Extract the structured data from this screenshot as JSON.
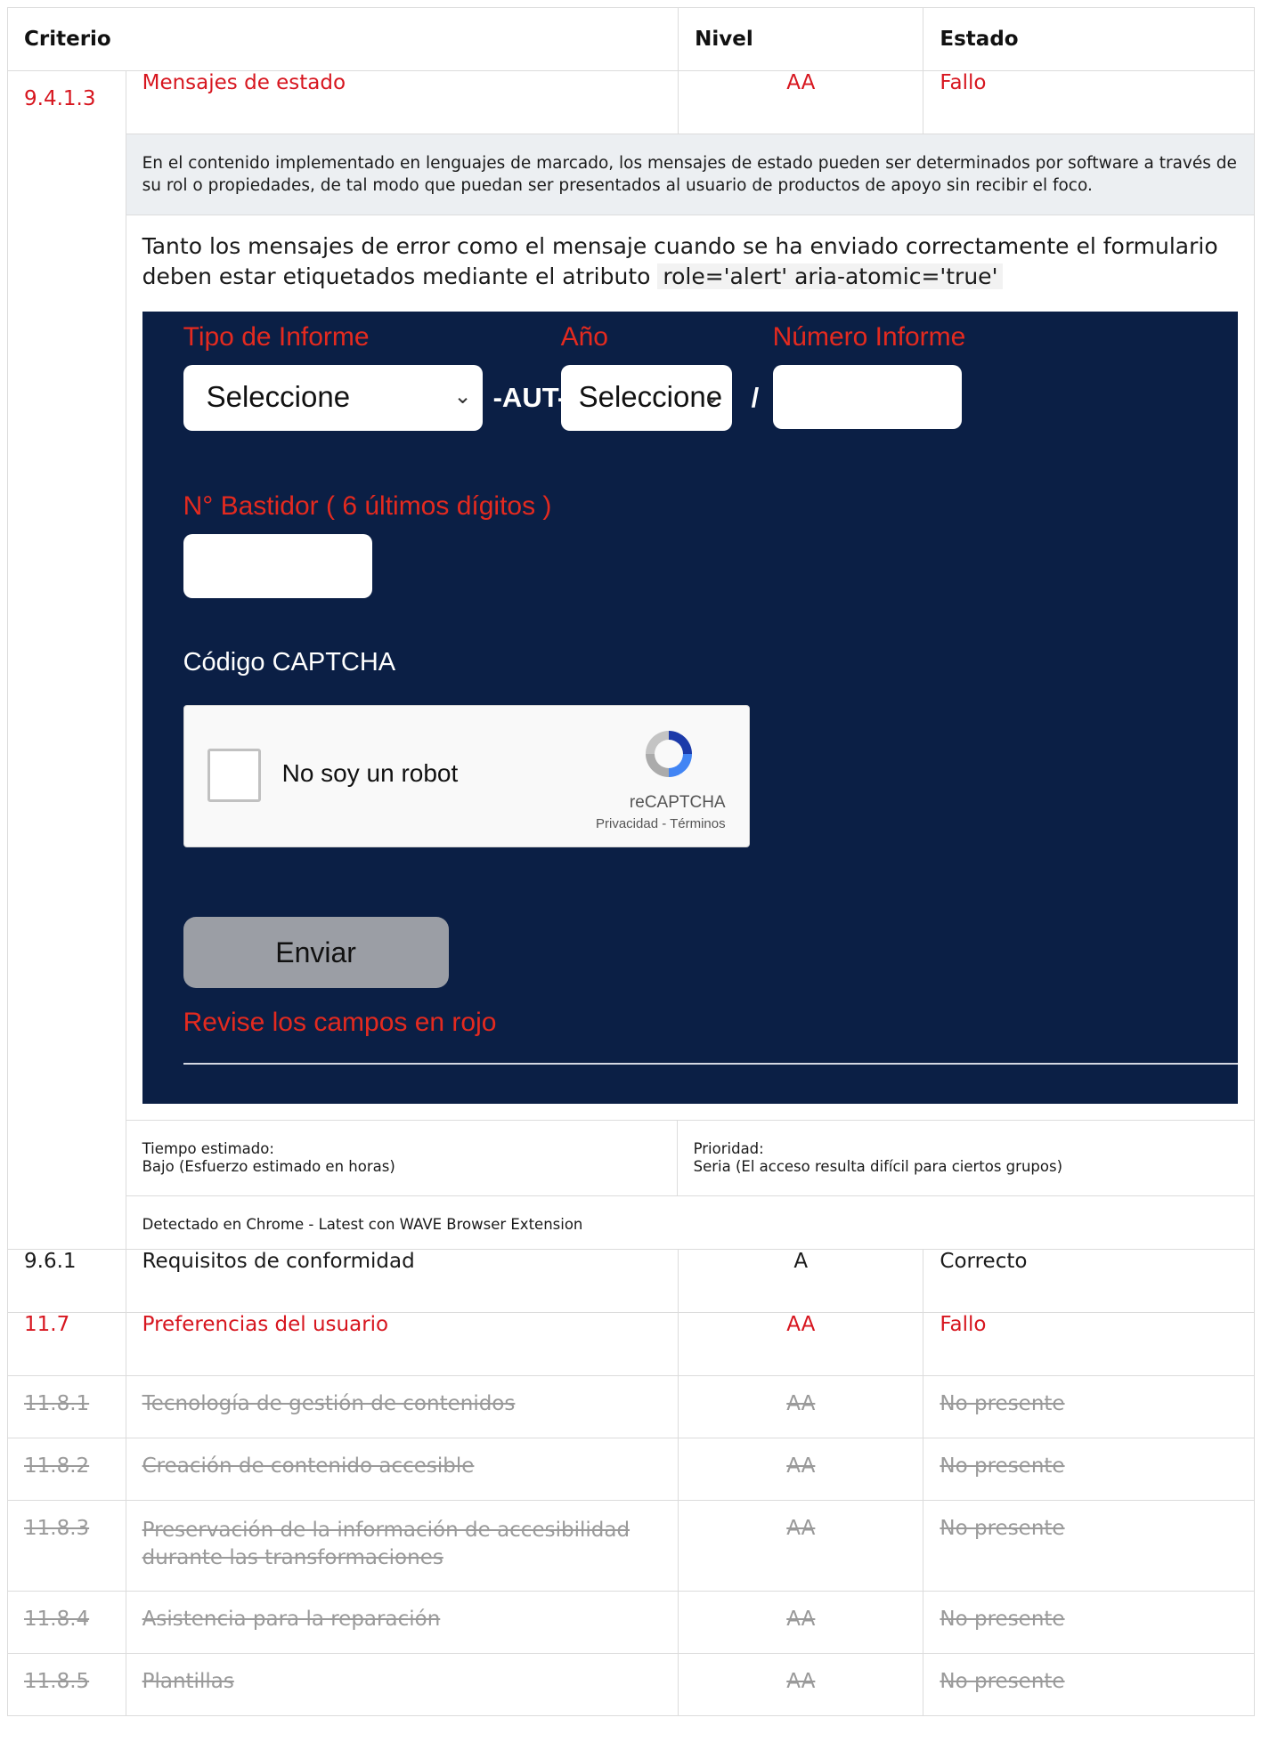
{
  "headers": {
    "criterio": "Criterio",
    "nivel": "Nivel",
    "estado": "Estado"
  },
  "rows": [
    {
      "id": "9.4.1.3",
      "name": "Mensajes de estado",
      "level": "AA",
      "status": "Fallo"
    },
    {
      "id": "9.6.1",
      "name": "Requisitos de conformidad",
      "level": "A",
      "status": "Correcto"
    },
    {
      "id": "11.7",
      "name": "Preferencias del usuario",
      "level": "AA",
      "status": "Fallo"
    },
    {
      "id": "11.8.1",
      "name": "Tecnología de gestión de contenidos",
      "level": "AA",
      "status": "No presente"
    },
    {
      "id": "11.8.2",
      "name": "Creación de contenido accesible",
      "level": "AA",
      "status": "No presente"
    },
    {
      "id": "11.8.3",
      "name": "Preservación de la información de accesibilidad durante las transformaciones",
      "level": "AA",
      "status": "No presente"
    },
    {
      "id": "11.8.4",
      "name": "Asistencia para la reparación",
      "level": "AA",
      "status": "No presente"
    },
    {
      "id": "11.8.5",
      "name": "Plantillas",
      "level": "AA",
      "status": "No presente"
    }
  ],
  "detail": {
    "description": "En el contenido implementado en lenguajes de marcado, los mensajes de estado pueden ser determinados por software a través de su rol o propiedades, de tal modo que puedan ser presentados al usuario de productos de apoyo sin recibir el foco.",
    "explanation": "Tanto los mensajes de error como el mensaje cuando se ha enviado correctamente el formulario deben estar etiquetados mediante el atributo",
    "code": "role='alert' aria-atomic='true'",
    "time_label": "Tiempo estimado:",
    "time_value": "Bajo (Esfuerzo estimado en horas)",
    "priority_label": "Prioridad:",
    "priority_value": "Seria (El acceso resulta difícil para ciertos grupos)",
    "detected": "Detectado en Chrome - Latest con WAVE Browser Extension"
  },
  "form": {
    "tipo_label": "Tipo de Informe",
    "anio_label": "Año",
    "numero_label": "Número Informe",
    "tipo_value": "Seleccione",
    "anio_value": "Seleccione",
    "aut_sep": "-AUT-",
    "slash_sep": "/",
    "bastidor_label": "N° Bastidor ( 6 últimos dígitos )",
    "captcha_label": "Código CAPTCHA",
    "robot_text": "No soy un robot",
    "recaptcha_brand": "reCAPTCHA",
    "recaptcha_links": "Privacidad - Términos",
    "submit": "Enviar",
    "error": "Revise los campos en rojo"
  },
  "colors": {
    "fail": "#d7161f",
    "form_bg": "#0b1f45",
    "form_label": "#e42a1f"
  }
}
